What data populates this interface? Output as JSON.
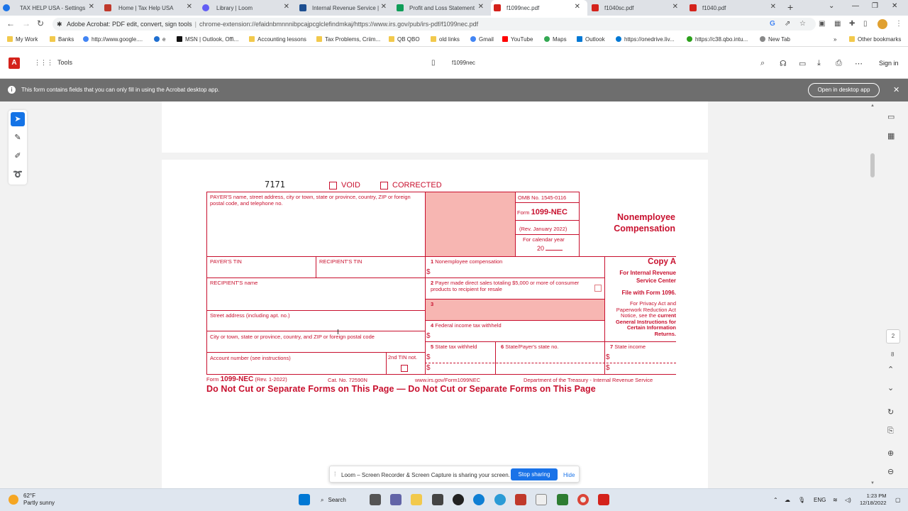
{
  "tabs": [
    {
      "label": "TAX HELP USA - Settings",
      "color": "#1a73e8"
    },
    {
      "label": "Home | Tax Help USA",
      "color": "#c0392b"
    },
    {
      "label": "Library | Loom",
      "color": "#625df5"
    },
    {
      "label": "Internal Revenue Service |",
      "color": "#1d4f91"
    },
    {
      "label": "Profit and Loss Statement",
      "color": "#0f9d58"
    },
    {
      "label": "f1099nec.pdf",
      "color": "#d4221b",
      "active": true
    },
    {
      "label": "f1040sc.pdf",
      "color": "#d4221b"
    },
    {
      "label": "f1040.pdf",
      "color": "#d4221b"
    }
  ],
  "address": {
    "site": "Adobe Acrobat: PDF edit, convert, sign tools",
    "url": "chrome-extension://efaidnbmnnnibpcajpcglclefindmkaj/https://www.irs.gov/pub/irs-pdf/f1099nec.pdf"
  },
  "bookmarks": [
    "My Work",
    "Banks",
    "http://www.google....",
    "e",
    "MSN | Outlook, Offi...",
    "Accounting lessons",
    "Tax Problems, Criim...",
    "QB QBO",
    "old links",
    "Gmail",
    "YouTube",
    "Maps",
    "Outlook",
    "https://onedrive.liv...",
    "https://c38.qbo.intu...",
    "New Tab"
  ],
  "other_bookmarks": "Other bookmarks",
  "acrobat": {
    "tools": "Tools",
    "doc_name": "f1099nec",
    "sign_in": "Sign in",
    "banner": "This form contains fields that you can only fill in using the Acrobat desktop app.",
    "open_desktop": "Open in desktop app"
  },
  "page_nav": {
    "current": "2",
    "total": "8"
  },
  "form": {
    "code": "7171",
    "void": "VOID",
    "corrected": "CORRECTED",
    "payer_name": "PAYER'S name, street address, city or town, state or province, country, ZIP or foreign postal code, and telephone no.",
    "omb": "OMB No. 1545-0116",
    "form_word": "Form",
    "form_num": "1099-NEC",
    "rev": "(Rev. January 2022)",
    "cal_year": "For calendar year",
    "year": "20",
    "title1": "Nonemployee",
    "title2": "Compensation",
    "payer_tin": "PAYER'S TIN",
    "recipient_tin": "RECIPIENT'S TIN",
    "box1": "Nonemployee compensation",
    "copy_a": "Copy A",
    "for_irs": "For Internal Revenue Service Center",
    "file_with": "File with Form 1096.",
    "privacy": "For Privacy Act and Paperwork Reduction Act Notice, see the",
    "privacy_bold": "current General Instructions for Certain Information Returns.",
    "recipient_name": "RECIPIENT'S name",
    "box2": "Payer made direct sales totaling $5,000 or more of consumer products to recipient for resale",
    "street": "Street address (including apt. no.)",
    "box3": "3",
    "city": "City or town, state or province, country, and ZIP or foreign postal code",
    "box4": "Federal income tax withheld",
    "account": "Account number (see instructions)",
    "tin2": "2nd TIN not.",
    "box5": "State tax withheld",
    "box6": "State/Payer's state no.",
    "box7": "State income",
    "n1": "1",
    "n2": "2",
    "n4": "4",
    "n5": "5",
    "n6": "6",
    "n7": "7",
    "dollar": "$",
    "foot_form": "Form",
    "foot_num": "1099-NEC",
    "foot_rev": "(Rev. 1-2022)",
    "foot_cat": "Cat. No. 72590N",
    "foot_url": "www.irs.gov/Form1099NEC",
    "foot_dept": "Department of the Treasury - Internal Revenue Service",
    "do_not_cut": "Do Not Cut or Separate Forms on This Page — Do Not Cut or Separate Forms on This Page"
  },
  "loom": {
    "message": "Loom – Screen Recorder & Screen Capture is sharing your screen.",
    "stop": "Stop sharing",
    "hide": "Hide"
  },
  "taskbar": {
    "temp": "62°F",
    "weather": "Partly sunny",
    "search": "Search",
    "lang": "ENG",
    "time": "1:23 PM",
    "date": "12/18/2022"
  }
}
